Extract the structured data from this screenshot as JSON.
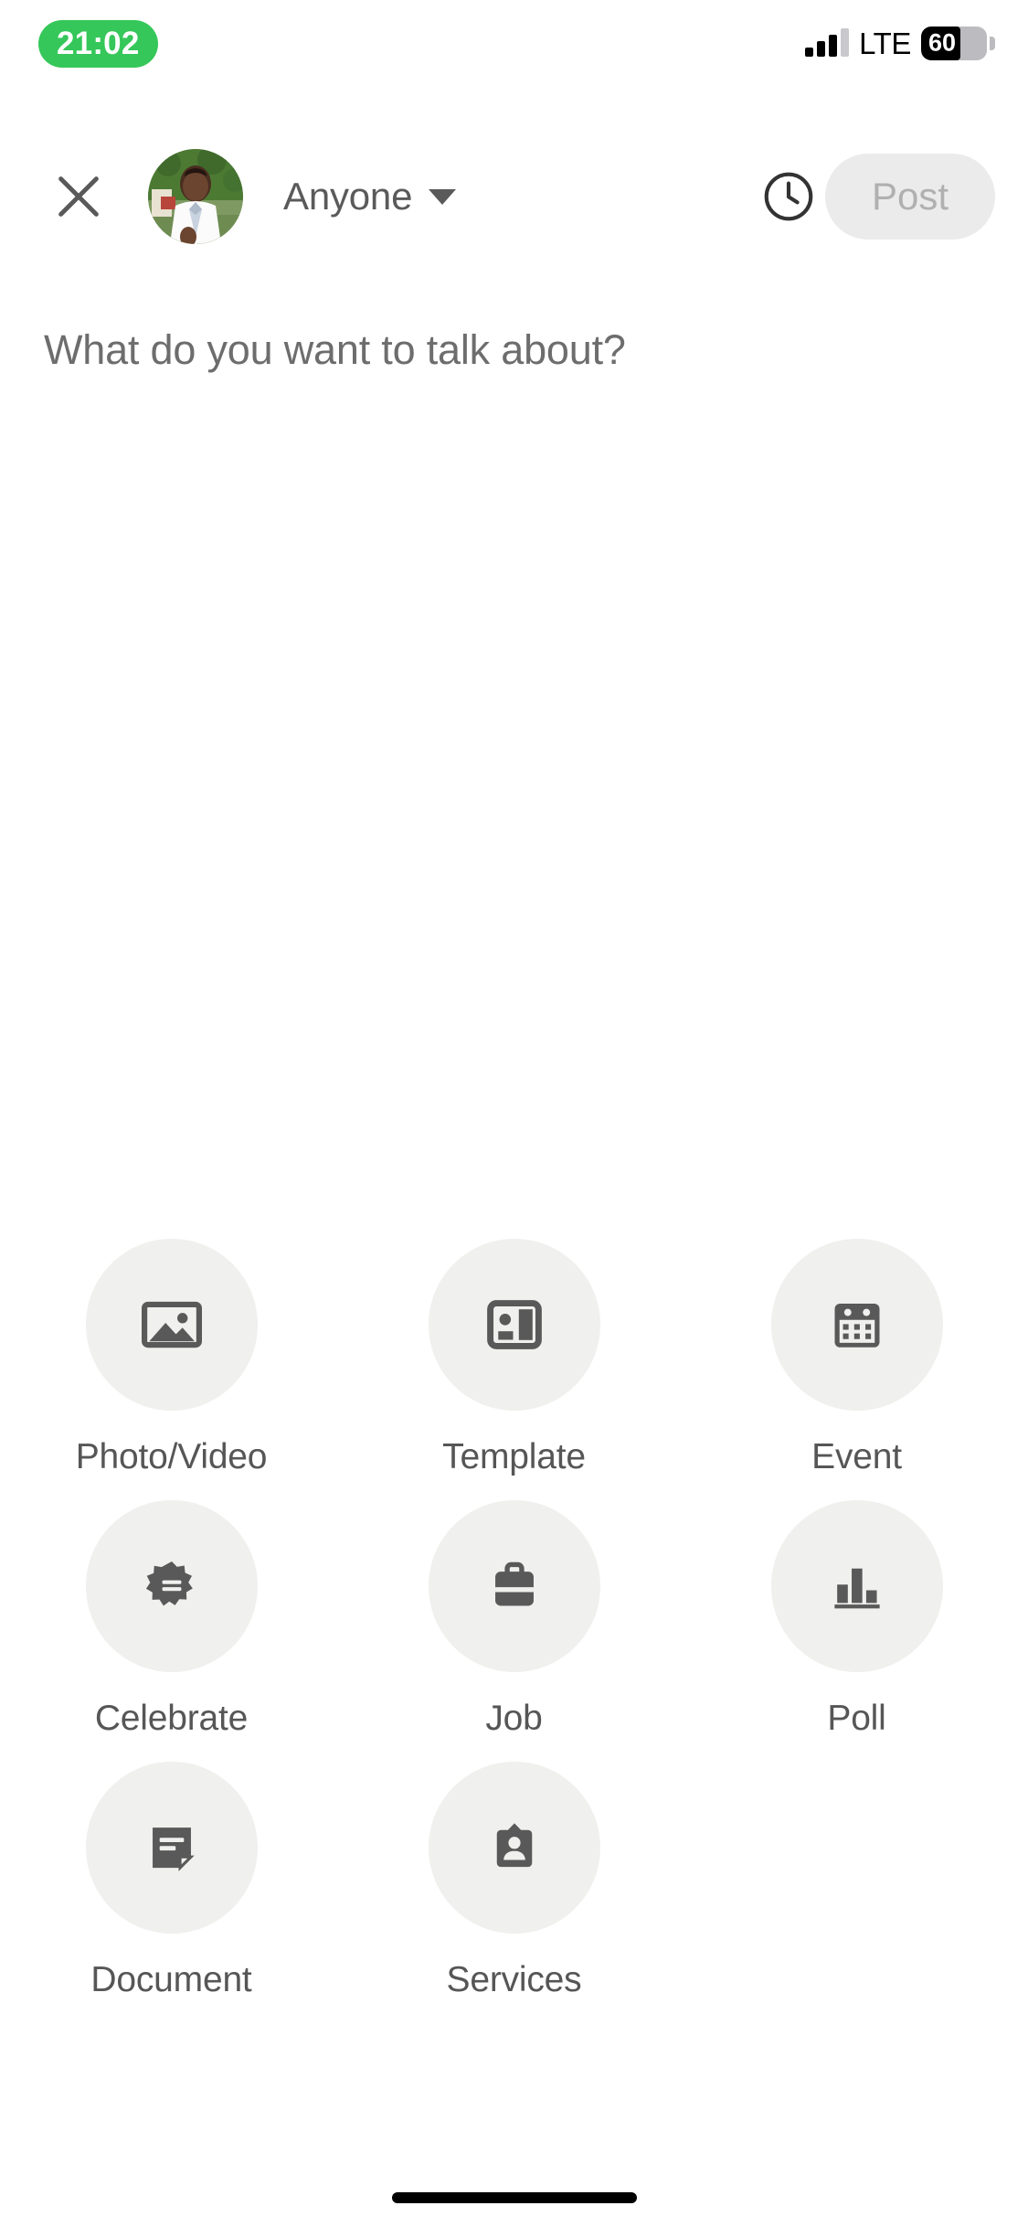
{
  "status_bar": {
    "time": "21:02",
    "time_pill_color": "#35c759",
    "network_label": "LTE",
    "battery_percent": "60",
    "signal_icon": "signal-bars-icon",
    "battery_icon": "battery-icon"
  },
  "navbar": {
    "close_icon": "close-icon",
    "avatar_name": "avatar",
    "audience_label": "Anyone",
    "caret_icon": "chevron-down-icon",
    "clock_icon": "clock-icon",
    "post_label": "Post",
    "post_enabled": false
  },
  "composer": {
    "placeholder": "What do you want to talk about?",
    "value": ""
  },
  "actions": {
    "rows": [
      [
        {
          "label": "Photo/Video",
          "icon": "image-icon"
        },
        {
          "label": "Template",
          "icon": "template-icon"
        },
        {
          "label": "Event",
          "icon": "calendar-icon"
        }
      ],
      [
        {
          "label": "Celebrate",
          "icon": "celebrate-badge-icon"
        },
        {
          "label": "Job",
          "icon": "briefcase-icon"
        },
        {
          "label": "Poll",
          "icon": "bar-chart-icon"
        }
      ],
      [
        {
          "label": "Document",
          "icon": "document-icon"
        },
        {
          "label": "Services",
          "icon": "services-badge-icon"
        },
        {
          "label": "",
          "icon": ""
        }
      ]
    ]
  },
  "home_indicator": {
    "name": "home-indicator"
  },
  "colors": {
    "icon_gray": "#595959",
    "circle_bg": "#f0f0ee",
    "label_gray": "#565656",
    "placeholder_gray": "#6d6d6d",
    "post_disabled_bg": "#ebebeb",
    "post_disabled_text": "#b0b0b0",
    "status_green": "#35c759"
  }
}
